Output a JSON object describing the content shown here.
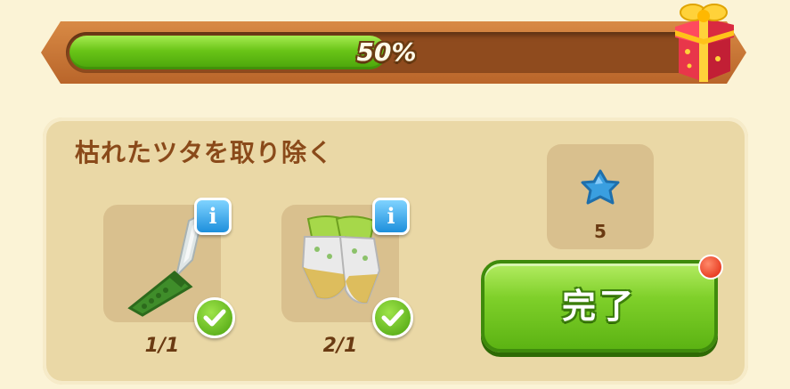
{
  "progress": {
    "percent_label": "50%",
    "fraction": 0.5,
    "bar_color": "#6bc418"
  },
  "reward_chest": {
    "icon": "gift-box-icon"
  },
  "task": {
    "title": "枯れたツタを取り除く",
    "required_items": [
      {
        "icon": "knife-icon",
        "count": "1/1",
        "info_icon": "info-icon",
        "status_icon": "check-icon"
      },
      {
        "icon": "gardening-gloves-icon",
        "count": "2/1",
        "info_icon": "info-icon",
        "status_icon": "check-icon"
      }
    ],
    "reward": {
      "icon": "blue-star-icon",
      "count": "5"
    },
    "complete_button": {
      "label": "完了",
      "accent": "#7fd02a"
    }
  }
}
